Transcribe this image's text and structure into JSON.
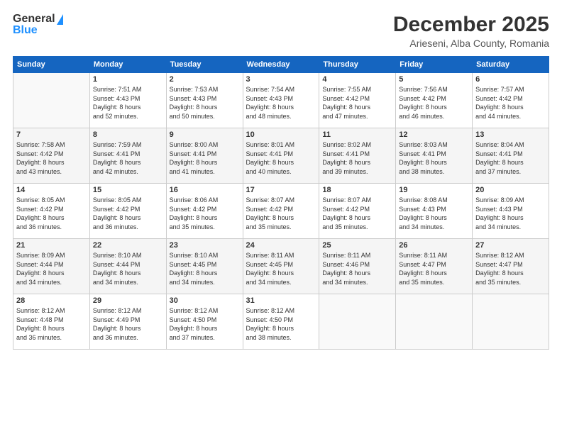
{
  "logo": {
    "general": "General",
    "blue": "Blue"
  },
  "title": {
    "month": "December 2025",
    "location": "Arieseni, Alba County, Romania"
  },
  "calendar": {
    "headers": [
      "Sunday",
      "Monday",
      "Tuesday",
      "Wednesday",
      "Thursday",
      "Friday",
      "Saturday"
    ],
    "weeks": [
      [
        {
          "day": "",
          "info": ""
        },
        {
          "day": "1",
          "info": "Sunrise: 7:51 AM\nSunset: 4:43 PM\nDaylight: 8 hours\nand 52 minutes."
        },
        {
          "day": "2",
          "info": "Sunrise: 7:53 AM\nSunset: 4:43 PM\nDaylight: 8 hours\nand 50 minutes."
        },
        {
          "day": "3",
          "info": "Sunrise: 7:54 AM\nSunset: 4:43 PM\nDaylight: 8 hours\nand 48 minutes."
        },
        {
          "day": "4",
          "info": "Sunrise: 7:55 AM\nSunset: 4:42 PM\nDaylight: 8 hours\nand 47 minutes."
        },
        {
          "day": "5",
          "info": "Sunrise: 7:56 AM\nSunset: 4:42 PM\nDaylight: 8 hours\nand 46 minutes."
        },
        {
          "day": "6",
          "info": "Sunrise: 7:57 AM\nSunset: 4:42 PM\nDaylight: 8 hours\nand 44 minutes."
        }
      ],
      [
        {
          "day": "7",
          "info": "Sunrise: 7:58 AM\nSunset: 4:42 PM\nDaylight: 8 hours\nand 43 minutes."
        },
        {
          "day": "8",
          "info": "Sunrise: 7:59 AM\nSunset: 4:41 PM\nDaylight: 8 hours\nand 42 minutes."
        },
        {
          "day": "9",
          "info": "Sunrise: 8:00 AM\nSunset: 4:41 PM\nDaylight: 8 hours\nand 41 minutes."
        },
        {
          "day": "10",
          "info": "Sunrise: 8:01 AM\nSunset: 4:41 PM\nDaylight: 8 hours\nand 40 minutes."
        },
        {
          "day": "11",
          "info": "Sunrise: 8:02 AM\nSunset: 4:41 PM\nDaylight: 8 hours\nand 39 minutes."
        },
        {
          "day": "12",
          "info": "Sunrise: 8:03 AM\nSunset: 4:41 PM\nDaylight: 8 hours\nand 38 minutes."
        },
        {
          "day": "13",
          "info": "Sunrise: 8:04 AM\nSunset: 4:41 PM\nDaylight: 8 hours\nand 37 minutes."
        }
      ],
      [
        {
          "day": "14",
          "info": "Sunrise: 8:05 AM\nSunset: 4:42 PM\nDaylight: 8 hours\nand 36 minutes."
        },
        {
          "day": "15",
          "info": "Sunrise: 8:05 AM\nSunset: 4:42 PM\nDaylight: 8 hours\nand 36 minutes."
        },
        {
          "day": "16",
          "info": "Sunrise: 8:06 AM\nSunset: 4:42 PM\nDaylight: 8 hours\nand 35 minutes."
        },
        {
          "day": "17",
          "info": "Sunrise: 8:07 AM\nSunset: 4:42 PM\nDaylight: 8 hours\nand 35 minutes."
        },
        {
          "day": "18",
          "info": "Sunrise: 8:07 AM\nSunset: 4:42 PM\nDaylight: 8 hours\nand 35 minutes."
        },
        {
          "day": "19",
          "info": "Sunrise: 8:08 AM\nSunset: 4:43 PM\nDaylight: 8 hours\nand 34 minutes."
        },
        {
          "day": "20",
          "info": "Sunrise: 8:09 AM\nSunset: 4:43 PM\nDaylight: 8 hours\nand 34 minutes."
        }
      ],
      [
        {
          "day": "21",
          "info": "Sunrise: 8:09 AM\nSunset: 4:44 PM\nDaylight: 8 hours\nand 34 minutes."
        },
        {
          "day": "22",
          "info": "Sunrise: 8:10 AM\nSunset: 4:44 PM\nDaylight: 8 hours\nand 34 minutes."
        },
        {
          "day": "23",
          "info": "Sunrise: 8:10 AM\nSunset: 4:45 PM\nDaylight: 8 hours\nand 34 minutes."
        },
        {
          "day": "24",
          "info": "Sunrise: 8:11 AM\nSunset: 4:45 PM\nDaylight: 8 hours\nand 34 minutes."
        },
        {
          "day": "25",
          "info": "Sunrise: 8:11 AM\nSunset: 4:46 PM\nDaylight: 8 hours\nand 34 minutes."
        },
        {
          "day": "26",
          "info": "Sunrise: 8:11 AM\nSunset: 4:47 PM\nDaylight: 8 hours\nand 35 minutes."
        },
        {
          "day": "27",
          "info": "Sunrise: 8:12 AM\nSunset: 4:47 PM\nDaylight: 8 hours\nand 35 minutes."
        }
      ],
      [
        {
          "day": "28",
          "info": "Sunrise: 8:12 AM\nSunset: 4:48 PM\nDaylight: 8 hours\nand 36 minutes."
        },
        {
          "day": "29",
          "info": "Sunrise: 8:12 AM\nSunset: 4:49 PM\nDaylight: 8 hours\nand 36 minutes."
        },
        {
          "day": "30",
          "info": "Sunrise: 8:12 AM\nSunset: 4:50 PM\nDaylight: 8 hours\nand 37 minutes."
        },
        {
          "day": "31",
          "info": "Sunrise: 8:12 AM\nSunset: 4:50 PM\nDaylight: 8 hours\nand 38 minutes."
        },
        {
          "day": "",
          "info": ""
        },
        {
          "day": "",
          "info": ""
        },
        {
          "day": "",
          "info": ""
        }
      ]
    ]
  }
}
